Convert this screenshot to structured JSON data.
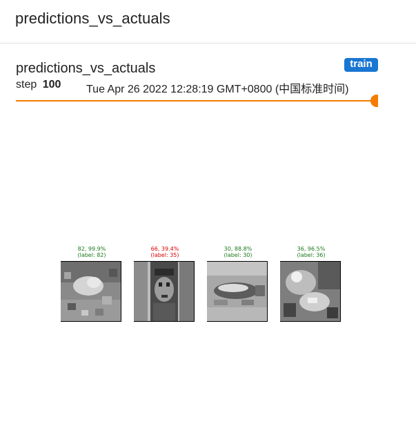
{
  "header": {
    "title": "predictions_vs_actuals"
  },
  "card": {
    "title": "predictions_vs_actuals",
    "run_badge": "train",
    "step_label": "step",
    "step_value": "100",
    "timestamp": "Tue Apr 26 2022 12:28:19 GMT+0800 (中国标准时间)",
    "slider_fraction": 1.0
  },
  "colors": {
    "accent": "#f57c00",
    "badge": "#1976d2",
    "correct": "#1a7a1a",
    "incorrect": "#d80000"
  },
  "samples": [
    {
      "line1": "82, 99.9%",
      "line2": "(label: 82)",
      "correct": true
    },
    {
      "line1": "66, 39.4%",
      "line2": "(label: 35)",
      "correct": false
    },
    {
      "line1": "30, 88.8%",
      "line2": "(label: 30)",
      "correct": true
    },
    {
      "line1": "36, 96.5%",
      "line2": "(label: 36)",
      "correct": true
    }
  ]
}
